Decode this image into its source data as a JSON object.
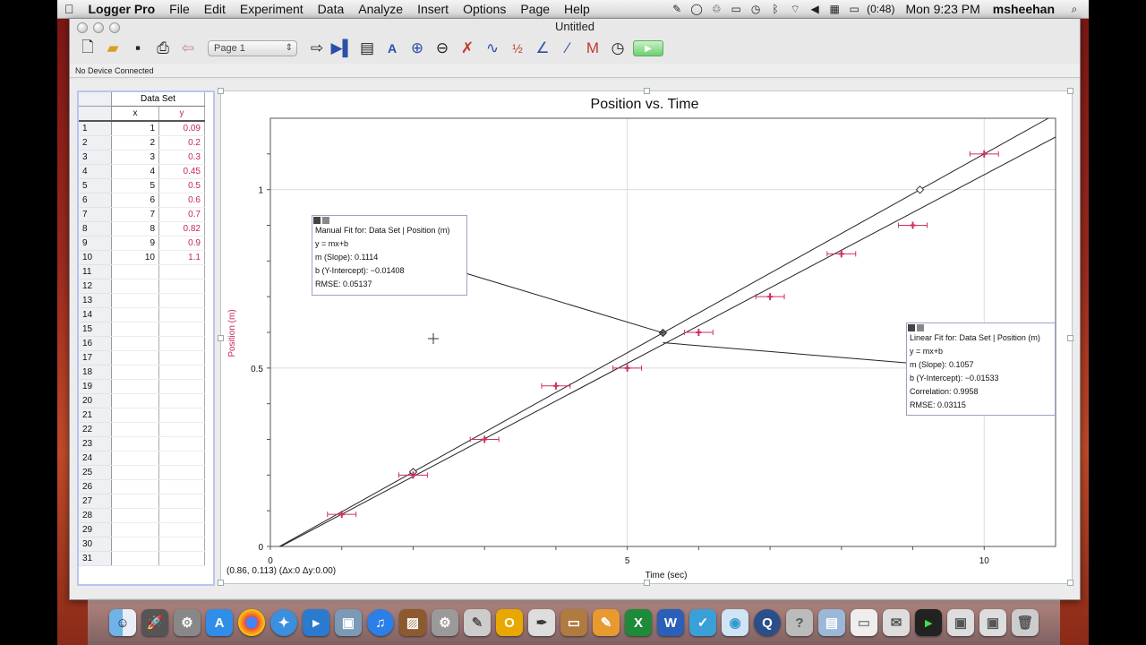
{
  "menubar": {
    "app_name": "Logger Pro",
    "items": [
      "File",
      "Edit",
      "Experiment",
      "Data",
      "Analyze",
      "Insert",
      "Options",
      "Page",
      "Help"
    ],
    "battery": "(0:48)",
    "clock": "Mon 9:23 PM",
    "user": "msheehan"
  },
  "window": {
    "title": "Untitled",
    "page_selector": "Page 1",
    "status": "No Device Connected"
  },
  "table": {
    "dataset_name": "Data Set",
    "col_x": "x",
    "col_y": "y",
    "row_numbers": [
      "1",
      "2",
      "3",
      "4",
      "5",
      "6",
      "7",
      "8",
      "9",
      "10",
      "11",
      "12",
      "13",
      "14",
      "15",
      "16",
      "17",
      "18",
      "19",
      "20",
      "21",
      "22",
      "23",
      "24",
      "25",
      "26",
      "27",
      "28",
      "29",
      "30",
      "31"
    ],
    "x": [
      "1",
      "2",
      "3",
      "4",
      "5",
      "6",
      "7",
      "8",
      "9",
      "10"
    ],
    "y": [
      "0.09",
      "0.2",
      "0.3",
      "0.45",
      "0.5",
      "0.6",
      "0.7",
      "0.82",
      "0.9",
      "1.1"
    ]
  },
  "graph": {
    "title": "Position vs. Time",
    "xlabel": "Time (sec)",
    "ylabel": "Position (m)",
    "readout": "(0.86, 0.113) (Δx:0 Δy:0.00)",
    "manual_fit": {
      "title": "Manual Fit for: Data Set | Position (m)",
      "equation": "y = mx+b",
      "slope": "m (Slope): 0.1114",
      "intercept": "b (Y-Intercept): −0.01408",
      "rmse": "RMSE: 0.05137"
    },
    "linear_fit": {
      "title": "Linear Fit for: Data Set | Position (m)",
      "equation": "y = mx+b",
      "slope": "m (Slope): 0.1057",
      "intercept": "b (Y-Intercept): −0.01533",
      "correlation": "Correlation: 0.9958",
      "rmse": "RMSE: 0.03115"
    }
  },
  "chart_data": {
    "type": "scatter",
    "title": "Position vs. Time",
    "xlabel": "Time (sec)",
    "ylabel": "Position (m)",
    "xlim": [
      0,
      11
    ],
    "ylim": [
      0,
      1.2
    ],
    "x_ticks": [
      "0",
      "5",
      "10"
    ],
    "y_ticks": [
      "0",
      "0.5",
      "1"
    ],
    "grid": true,
    "series": [
      {
        "x": [
          1,
          2,
          3,
          4,
          5,
          6,
          7,
          8,
          9,
          10
        ],
        "y": [
          0.09,
          0.2,
          0.3,
          0.45,
          0.5,
          0.6,
          0.7,
          0.82,
          0.9,
          1.1
        ],
        "color": "#d0305c"
      }
    ],
    "x_error": 0.2,
    "manual_fit": {
      "slope": 0.1114,
      "intercept": -0.01408
    },
    "linear_fit": {
      "slope": 0.1057,
      "intercept": -0.01533
    },
    "fit_line_color": "#222222"
  }
}
